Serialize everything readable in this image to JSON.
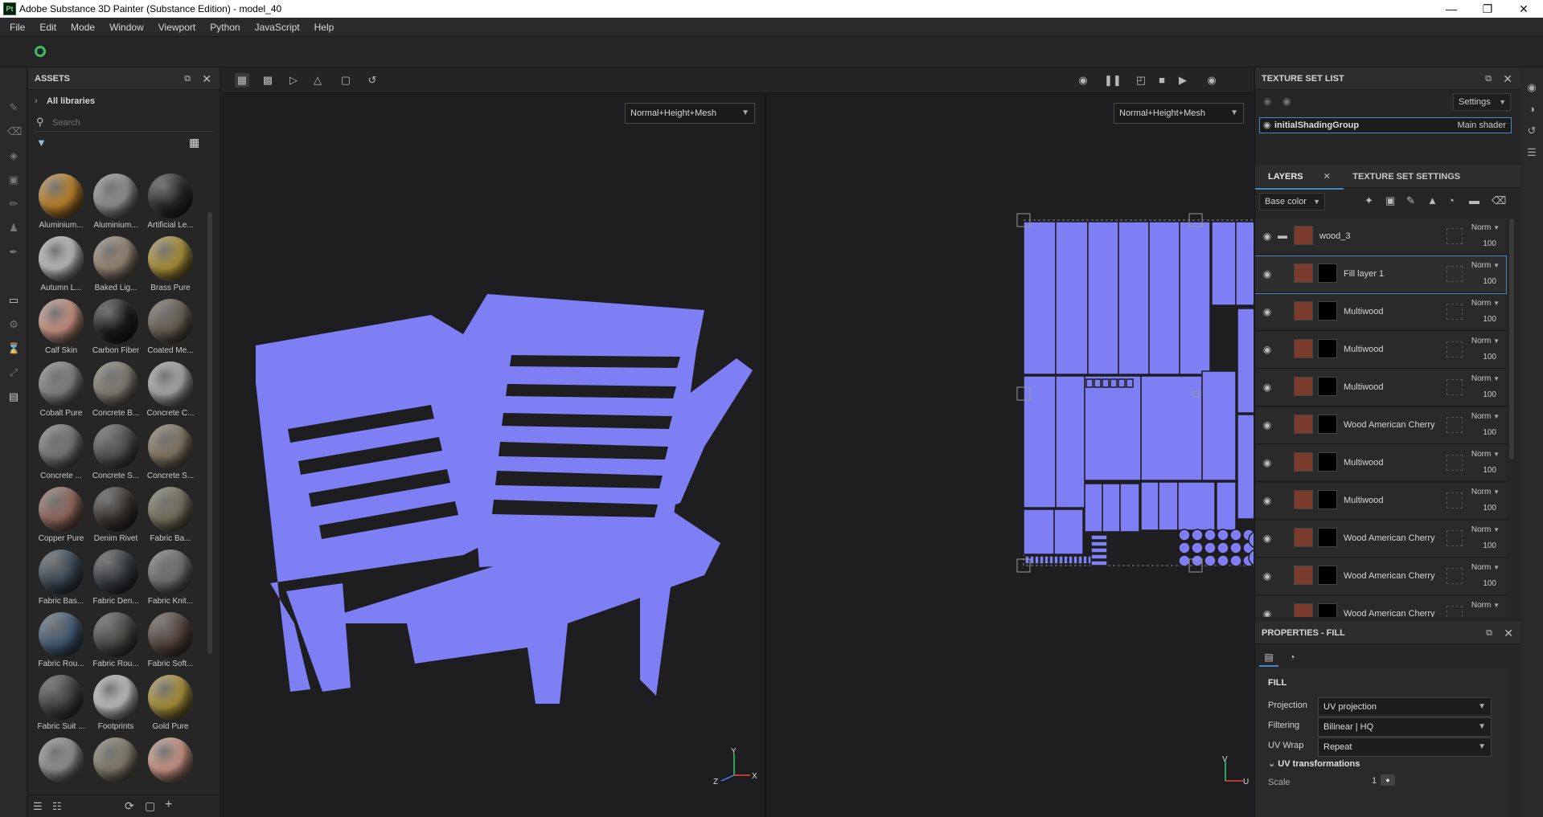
{
  "window": {
    "title": "Adobe Substance 3D Painter (Substance Edition) - model_40",
    "logo": "Pt"
  },
  "menu": [
    "File",
    "Edit",
    "Mode",
    "Window",
    "Viewport",
    "Python",
    "JavaScript",
    "Help"
  ],
  "assets": {
    "title": "ASSETS",
    "library": "All libraries",
    "search_placeholder": "Search",
    "items": [
      {
        "label": "Aluminium...",
        "color": "#c98a2a"
      },
      {
        "label": "Aluminium...",
        "color": "#9a9a9a"
      },
      {
        "label": "Artificial Le...",
        "color": "#2a2a2a"
      },
      {
        "label": "Autumn L...",
        "color": "#c9c9c9"
      },
      {
        "label": "Baked Lig...",
        "color": "#a08d7a"
      },
      {
        "label": "Brass Pure",
        "color": "#b59a3a"
      },
      {
        "label": "Calf Skin",
        "color": "#d59b88"
      },
      {
        "label": "Carbon Fiber",
        "color": "#1d1d1d"
      },
      {
        "label": "Coated Me...",
        "color": "#6d6455"
      },
      {
        "label": "Cobalt Pure",
        "color": "#8a8a8a"
      },
      {
        "label": "Concrete B...",
        "color": "#8a8478"
      },
      {
        "label": "Concrete C...",
        "color": "#b5b5b5"
      },
      {
        "label": "Concrete ...",
        "color": "#7e7e7e"
      },
      {
        "label": "Concrete S...",
        "color": "#555555"
      },
      {
        "label": "Concrete S...",
        "color": "#8b7d68"
      },
      {
        "label": "Copper Pure",
        "color": "#9a6e62"
      },
      {
        "label": "Denim Rivet",
        "color": "#3a3530"
      },
      {
        "label": "Fabric Ba...",
        "color": "#7e7a62"
      },
      {
        "label": "Fabric Bas...",
        "color": "#3d4d5a"
      },
      {
        "label": "Fabric Den...",
        "color": "#383c42"
      },
      {
        "label": "Fabric Knit...",
        "color": "#777777"
      },
      {
        "label": "Fabric Rou...",
        "color": "#45607a"
      },
      {
        "label": "Fabric Rou...",
        "color": "#4e4b48"
      },
      {
        "label": "Fabric Soft...",
        "color": "#5a4740"
      },
      {
        "label": "Fabric Suit ...",
        "color": "#444444"
      },
      {
        "label": "Footprints",
        "color": "#cccccc"
      },
      {
        "label": "Gold Pure",
        "color": "#b49a3c"
      },
      {
        "label": "",
        "color": "#9a9a9a"
      },
      {
        "label": "",
        "color": "#8a8470"
      },
      {
        "label": "",
        "color": "#d7a08e"
      }
    ]
  },
  "viewport": {
    "left_mode": "Normal+Height+Mesh",
    "right_mode": "Normal+Height+Mesh",
    "mesh_color": "#7f7ff5",
    "axis_3d": [
      "Y",
      "Z",
      "X"
    ],
    "axis_uv": [
      "V",
      "U"
    ]
  },
  "texture_set_list": {
    "title": "TEXTURE SET LIST",
    "settings_label": "Settings",
    "set_name": "initialShadingGroup",
    "shader": "Main shader"
  },
  "layers": {
    "tab_layers": "LAYERS",
    "tab_settings": "TEXTURE SET SETTINGS",
    "channel": "Base color",
    "items": [
      {
        "name": "wood_3",
        "blend": "Norm",
        "opacity": "100",
        "folder": true,
        "selected": false
      },
      {
        "name": "Fill layer 1",
        "blend": "Norm",
        "opacity": "100",
        "folder": false,
        "selected": true
      },
      {
        "name": "Multiwood",
        "blend": "Norm",
        "opacity": "100",
        "folder": false,
        "selected": false
      },
      {
        "name": "Multiwood",
        "blend": "Norm",
        "opacity": "100",
        "folder": false,
        "selected": false
      },
      {
        "name": "Multiwood",
        "blend": "Norm",
        "opacity": "100",
        "folder": false,
        "selected": false
      },
      {
        "name": "Wood American Cherry",
        "blend": "Norm",
        "opacity": "100",
        "folder": false,
        "selected": false
      },
      {
        "name": "Multiwood",
        "blend": "Norm",
        "opacity": "100",
        "folder": false,
        "selected": false
      },
      {
        "name": "Multiwood",
        "blend": "Norm",
        "opacity": "100",
        "folder": false,
        "selected": false
      },
      {
        "name": "Wood American Cherry",
        "blend": "Norm",
        "opacity": "100",
        "folder": false,
        "selected": false
      },
      {
        "name": "Wood American Cherry",
        "blend": "Norm",
        "opacity": "100",
        "folder": false,
        "selected": false
      },
      {
        "name": "Wood American Cherry",
        "blend": "Norm",
        "opacity": "",
        "folder": false,
        "selected": false
      }
    ]
  },
  "properties": {
    "title": "PROPERTIES - FILL",
    "section": "FILL",
    "projection_label": "Projection",
    "projection_value": "UV projection",
    "filtering_label": "Filtering",
    "filtering_value": "Bilinear | HQ",
    "uvwrap_label": "UV Wrap",
    "uvwrap_value": "Repeat",
    "uvtrans_label": "UV transformations",
    "scale_label": "Scale",
    "scale_value": "1"
  }
}
